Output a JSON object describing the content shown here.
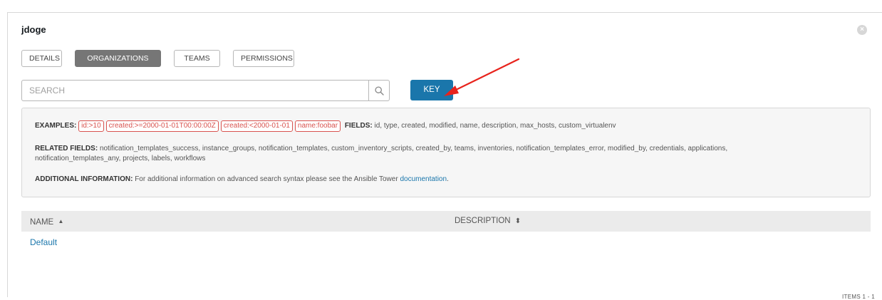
{
  "header": {
    "title": "jdoge",
    "close_glyph": "×"
  },
  "tabs": [
    {
      "label": "DETAILS",
      "active": false
    },
    {
      "label": "ORGANIZATIONS",
      "active": true
    },
    {
      "label": "TEAMS",
      "active": false
    },
    {
      "label": "PERMISSIONS",
      "active": false
    }
  ],
  "search": {
    "placeholder": "SEARCH",
    "value": "",
    "icon": "search-icon",
    "key_label": "KEY"
  },
  "key_panel": {
    "examples_label": "EXAMPLES:",
    "examples": [
      "id:>10",
      "created:>=2000-01-01T00:00:00Z",
      "created:<2000-01-01",
      "name:foobar"
    ],
    "fields_label": "FIELDS:",
    "fields": "id, type, created, modified, name, description, max_hosts, custom_virtualenv",
    "related_label": "RELATED FIELDS:",
    "related_line1": "notification_templates_success, instance_groups, notification_templates, custom_inventory_scripts, created_by, teams, inventories, notification_templates_error, modified_by, credentials, applications,",
    "related_line2": "notification_templates_any, projects, labels, workflows",
    "additional_label": "ADDITIONAL INFORMATION:",
    "additional_text": "For additional information on advanced search syntax please see the Ansible Tower",
    "doc_link": "documentation",
    "doc_suffix": "."
  },
  "table": {
    "columns": [
      {
        "label": "NAME",
        "sort_icon": "▲"
      },
      {
        "label": "DESCRIPTION",
        "sort_icon": "⬍"
      }
    ],
    "rows": [
      {
        "name": "Default",
        "description": ""
      }
    ],
    "items_label": "ITEMS  1 - 1"
  },
  "colors": {
    "accent": "#1a76ab",
    "tab_active": "#767676",
    "chip": "#d9534f",
    "annotation_arrow": "#e8231c"
  }
}
